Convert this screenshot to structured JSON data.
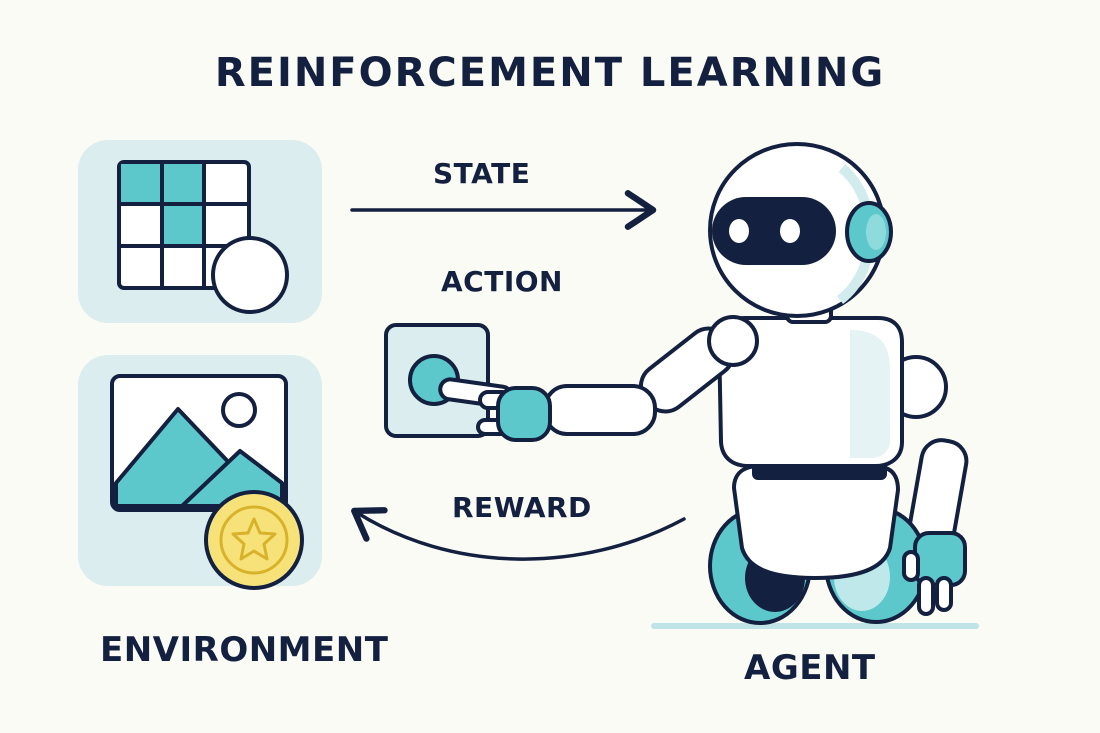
{
  "title": "REINFORCEMENT LEARNING",
  "labels": {
    "state": "STATE",
    "action": "ACTION",
    "reward": "REWARD",
    "environment": "ENVIRONMENT",
    "agent": "AGENT"
  },
  "icons": {
    "environment_grid": "grid-with-circle-icon",
    "environment_image": "image-landscape-icon",
    "reward_coin": "star-coin-icon",
    "action_button": "push-button-icon",
    "agent": "robot-icon"
  },
  "colors": {
    "ink": "#13203f",
    "teal": "#5cc8cc",
    "panel": "#d9edef",
    "coin": "#f7e27a",
    "coin_edge": "#d9b22c",
    "background": "#fbfbf6"
  }
}
